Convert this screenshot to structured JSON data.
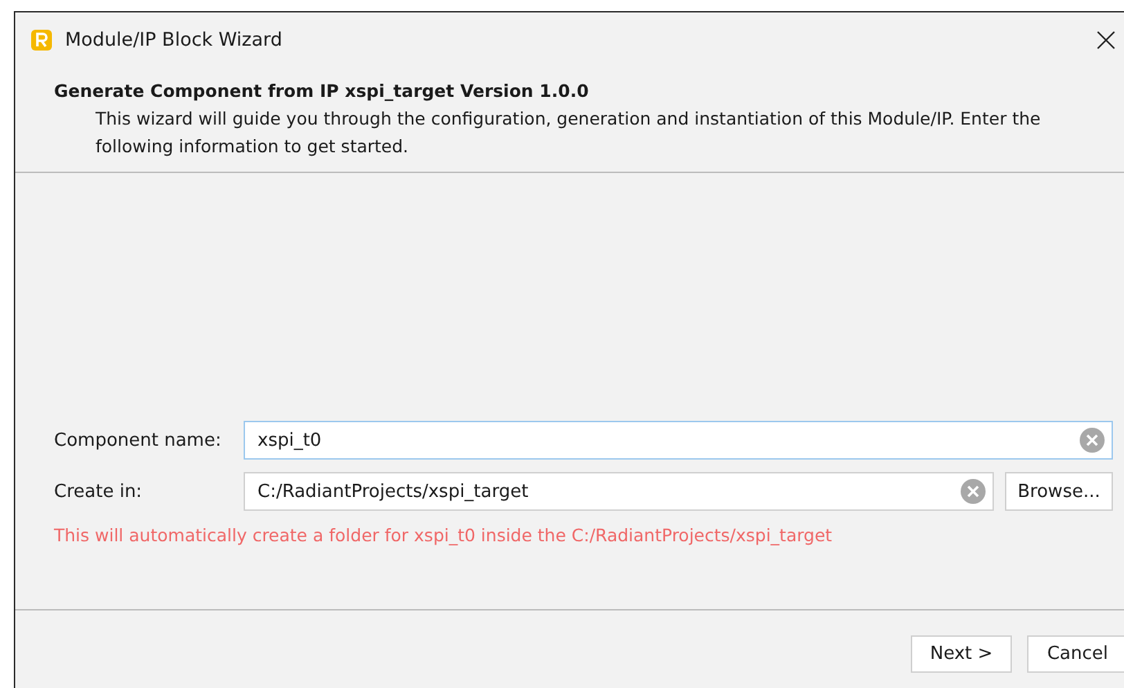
{
  "window": {
    "title": "Module/IP Block Wizard"
  },
  "header": {
    "title": "Generate Component from IP xspi_target Version 1.0.0",
    "description": "This wizard will guide you through the configuration, generation and instantiation of this Module/IP. Enter the following information to get started."
  },
  "fields": [
    {
      "label": "Component name:",
      "value": "xspi_t0",
      "focused": true
    },
    {
      "label": "Create in:",
      "value": "C:/RadiantProjects/xspi_target",
      "focused": false,
      "button": "Browse..."
    }
  ],
  "message": "This will automatically create a folder for xspi_t0 inside the C:/RadiantProjects/xspi_target",
  "buttons": [
    "Next >",
    "Cancel"
  ]
}
